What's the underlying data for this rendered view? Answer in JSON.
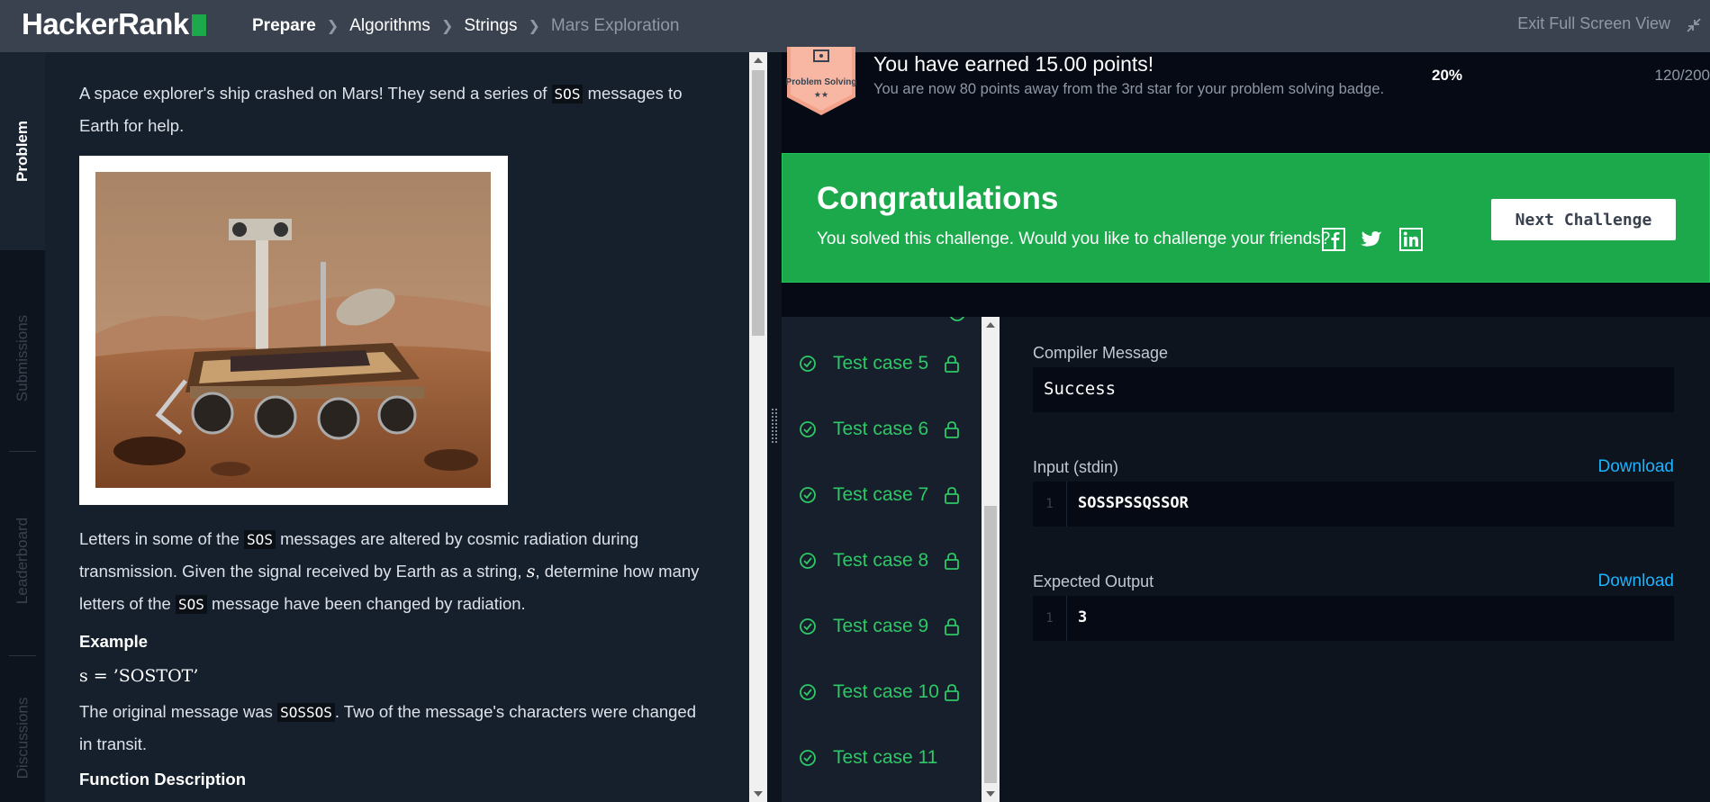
{
  "header": {
    "logo_text": "HackerRank",
    "breadcrumb": [
      "Prepare",
      "Algorithms",
      "Strings",
      "Mars Exploration"
    ],
    "exit_fullscreen": "Exit Full Screen View"
  },
  "sidetabs": [
    "Problem",
    "Submissions",
    "Leaderboard",
    "Discussions"
  ],
  "problem": {
    "intro_1": "A space explorer's ship crashed on Mars! They send a series of ",
    "intro_code": "SOS",
    "intro_2": " messages to Earth for help.",
    "p2_a": "Letters in some of the ",
    "p2_code1": "SOS",
    "p2_b": " messages are altered by cosmic radiation during transmission. Given the signal received by Earth as a string, ",
    "p2_var": "s",
    "p2_c": ", determine how many letters of the ",
    "p2_code2": "SOS",
    "p2_d": " message have been changed by radiation.",
    "example_heading": "Example",
    "example_math": "s = ’SOSTOT’",
    "p3_a": "The original message was ",
    "p3_code": "SOSSOS",
    "p3_b": ". Two of the message's characters were changed in transit.",
    "function_heading": "Function Description"
  },
  "points_bar": {
    "badge_label": "Problem Solving",
    "badge_stars": "★★",
    "earned": "You have earned 15.00 points!",
    "away": "You are now 80 points away from the 3rd star for your problem solving badge.",
    "percent": "20%",
    "points": "120/200"
  },
  "congrats": {
    "title": "Congratulations",
    "subtitle": "You solved this challenge. Would you like to challenge your friends?",
    "next_button": "Next Challenge"
  },
  "test_cases": [
    {
      "label": "Test case 5",
      "locked": true
    },
    {
      "label": "Test case 6",
      "locked": true
    },
    {
      "label": "Test case 7",
      "locked": true
    },
    {
      "label": "Test case 8",
      "locked": true
    },
    {
      "label": "Test case 9",
      "locked": true
    },
    {
      "label": "Test case 10",
      "locked": true
    },
    {
      "label": "Test case 11",
      "locked": false
    }
  ],
  "results": {
    "compiler_label": "Compiler Message",
    "compiler_value": "Success",
    "input_label": "Input (stdin)",
    "input_line_no": "1",
    "input_value": "SOSSPSSQSSOR",
    "expected_label": "Expected Output",
    "expected_line_no": "1",
    "expected_value": "3",
    "download_label": "Download"
  },
  "colors": {
    "brand_green": "#1ba94c",
    "success_text": "#2ec866",
    "link_blue": "#1cb3ff",
    "topbar": "#39424e"
  }
}
